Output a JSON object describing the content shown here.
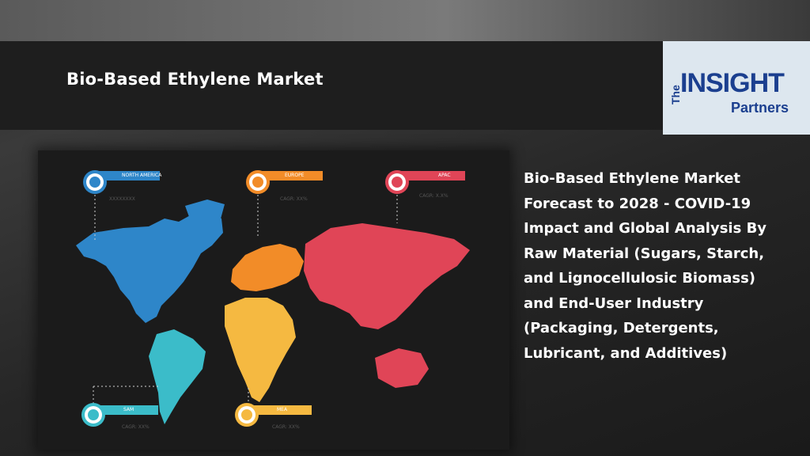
{
  "header": {
    "title": "Bio-Based Ethylene Market"
  },
  "logo": {
    "prefix": "The",
    "name": "INSIGHT",
    "suffix": "Partners",
    "color": "#1b3f8f"
  },
  "description": {
    "lines": [
      "Bio-Based Ethylene Market",
      "Forecast to 2028 - COVID-19",
      "Impact and Global Analysis By",
      "Raw Material (Sugars, Starch,",
      "and Lignocellulosic Biomass)",
      "and End-User Industry",
      "(Packaging, Detergents,",
      "Lubricant, and Additives)"
    ]
  },
  "map": {
    "regions": [
      {
        "label": "NORTH AMERICA",
        "sub": "XXXXXXXX",
        "color": "#2e86c9"
      },
      {
        "label": "EUROPE",
        "sub": "CAGR: XX%",
        "color": "#f28c28"
      },
      {
        "label": "APAC",
        "sub": "CAGR: X.X%",
        "color": "#e04557"
      },
      {
        "label": "SAM",
        "sub": "CAGR: XX%",
        "color": "#3bbcc9"
      },
      {
        "label": "MEA",
        "sub": "CAGR: XX%",
        "color": "#f5b941"
      }
    ]
  }
}
